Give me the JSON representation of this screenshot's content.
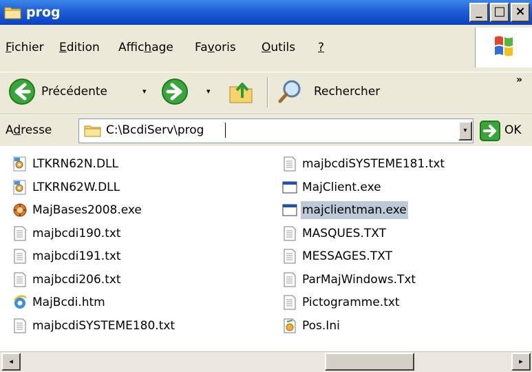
{
  "window": {
    "title": "prog",
    "minimize_label": "_",
    "maximize_label": "□",
    "close_label": "×"
  },
  "menu": {
    "items": [
      {
        "pre": "",
        "u": "F",
        "post": "ichier"
      },
      {
        "pre": "",
        "u": "E",
        "post": "dition"
      },
      {
        "pre": "Affic",
        "u": "h",
        "post": "age"
      },
      {
        "pre": "Fa",
        "u": "v",
        "post": "oris"
      },
      {
        "pre": "",
        "u": "O",
        "post": "utils"
      },
      {
        "pre": "",
        "u": "?",
        "post": ""
      }
    ]
  },
  "toolbar": {
    "back_label": "Précédente",
    "dropdown_glyph": "▾",
    "search_label": "Rechercher",
    "more_glyph": "»"
  },
  "address": {
    "label_pre": "A",
    "label_u": "d",
    "label_post": "resse",
    "value": "C:\\BcdiServ\\prog",
    "go_label": "OK"
  },
  "files": {
    "left": [
      {
        "name": "LTKRN62N.DLL",
        "icon": "dll-icon"
      },
      {
        "name": "LTKRN62W.DLL",
        "icon": "dll-icon"
      },
      {
        "name": "MajBases2008.exe",
        "icon": "installer-icon"
      },
      {
        "name": "majbcdi190.txt",
        "icon": "text-file-icon"
      },
      {
        "name": "majbcdi191.txt",
        "icon": "text-file-icon"
      },
      {
        "name": "majbcdi206.txt",
        "icon": "text-file-icon"
      },
      {
        "name": "MajBcdi.htm",
        "icon": "ie-html-icon"
      },
      {
        "name": "majbcdiSYSTEME180.txt",
        "icon": "text-file-icon"
      }
    ],
    "right": [
      {
        "name": "majbcdiSYSTEME181.txt",
        "icon": "text-file-icon",
        "selected": false
      },
      {
        "name": "MajClient.exe",
        "icon": "exe-window-icon",
        "selected": false
      },
      {
        "name": "majclientman.exe",
        "icon": "exe-window-icon",
        "selected": true
      },
      {
        "name": "MASQUES.TXT",
        "icon": "text-file-icon",
        "selected": false
      },
      {
        "name": "MESSAGES.TXT",
        "icon": "text-file-icon",
        "selected": false
      },
      {
        "name": "ParMajWindows.Txt",
        "icon": "text-file-icon",
        "selected": false
      },
      {
        "name": "Pictogramme.txt",
        "icon": "text-file-icon",
        "selected": false
      },
      {
        "name": "Pos.Ini",
        "icon": "ini-settings-icon",
        "selected": false
      }
    ]
  },
  "scrollbar": {
    "left_glyph": "◂",
    "right_glyph": "▸"
  }
}
